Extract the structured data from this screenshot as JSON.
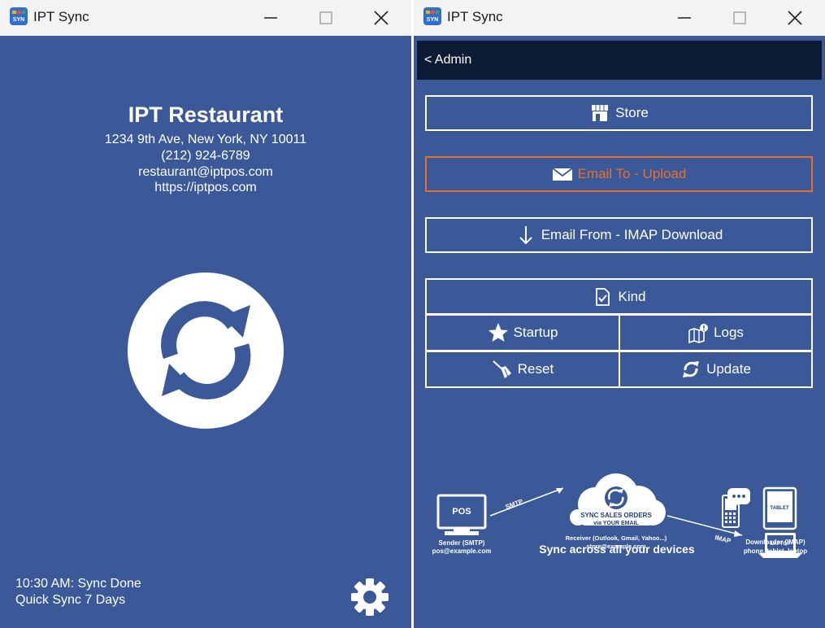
{
  "left_window": {
    "title": "IPT Sync",
    "restaurant": {
      "name": "IPT Restaurant",
      "address": "1234 9th Ave, New York, NY 10011",
      "phone": "(212) 924-6789",
      "email": "restaurant@iptpos.com",
      "website": "https://iptpos.com"
    },
    "status": {
      "line1": "10:30 AM: Sync Done",
      "line2": "Quick Sync 7 Days"
    },
    "icons": {
      "sync": "sync-icon",
      "settings": "gear-icon"
    }
  },
  "right_window": {
    "title": "IPT Sync",
    "back_label": "< Admin",
    "buttons": {
      "store": "Store",
      "email_to": "Email To - Upload",
      "email_from": "Email From - IMAP Download",
      "kind": "Kind",
      "startup": "Startup",
      "logs": "Logs",
      "reset": "Reset",
      "update": "Update"
    },
    "diagram": {
      "pos": "POS",
      "smtp": "SMTP",
      "imap": "IMAP",
      "cloud_line1": "SYNC SALES ORDERS",
      "cloud_line2": "via YOUR EMAIL",
      "receiver_line1": "Receiver (Outlook, Gmail, Yahoo...)",
      "receiver_line2": "store@example.com",
      "sender_line1": "Sender (SMTP)",
      "sender_line2": "pos@example.com",
      "tablet": "TABLET",
      "laptop": "LAPTOP",
      "downloader_line1": "Downloader (IMAP)",
      "downloader_line2": "phone, tablet, laptop",
      "tagline": "Sync across all your devices"
    }
  },
  "colors": {
    "background": "#3b5998",
    "admin_bar": "#0c1a33",
    "titlebar": "#f3f3f3",
    "accent_orange": "#e8702a",
    "text": "#ffffff"
  }
}
